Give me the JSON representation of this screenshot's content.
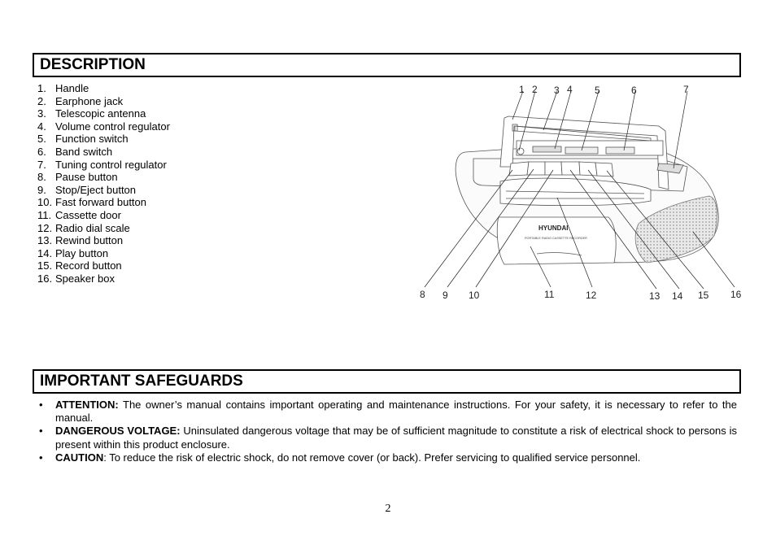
{
  "description": {
    "title": "DESCRIPTION",
    "parts": [
      {
        "num": "1.",
        "label": "Handle"
      },
      {
        "num": "2.",
        "label": "Earphone jack"
      },
      {
        "num": "3.",
        "label": "Telescopic antenna"
      },
      {
        "num": "4.",
        "label": "Volume control regulator"
      },
      {
        "num": "5.",
        "label": "Function switch"
      },
      {
        "num": "6.",
        "label": "Band switch"
      },
      {
        "num": "7.",
        "label": "Tuning control regulator"
      },
      {
        "num": "8.",
        "label": "Pause button"
      },
      {
        "num": "9.",
        "label": "Stop/Eject button"
      },
      {
        "num": "10.",
        "label": "Fast forward button"
      },
      {
        "num": "11.",
        "label": "Cassette door"
      },
      {
        "num": "12.",
        "label": "Radio dial scale"
      },
      {
        "num": "13.",
        "label": "Rewind button"
      },
      {
        "num": "14.",
        "label": "Play button"
      },
      {
        "num": "15.",
        "label": "Record button"
      },
      {
        "num": "16.",
        "label": "Speaker box"
      }
    ]
  },
  "diagram": {
    "brand": "HYUNDAI",
    "subtitle": "PORTABLE RADIO CASSETTE RECORDER",
    "callouts_top": [
      "1",
      "2",
      "3",
      "4",
      "5",
      "6",
      "7"
    ],
    "callouts_bottom": [
      "8",
      "9",
      "10",
      "11",
      "12",
      "13",
      "14",
      "15",
      "16"
    ]
  },
  "safeguards": {
    "title": "IMPORTANT SAFEGUARDS",
    "bullet": "•",
    "items": [
      {
        "label": "ATTENTION:",
        "text": " The owner’s manual contains important operating and maintenance instructions. For your safety, it is necessary to refer to the manual."
      },
      {
        "label": "DANGEROUS VOLTAGE:",
        "text": " Uninsulated dangerous voltage that may be of sufficient magnitude to constitute a risk of electrical shock to persons is present within this product enclosure."
      },
      {
        "label": "CAUTION",
        "text": ":  To reduce the risk of electric shock, do not remove cover (or back). Prefer servicing to qualified service personnel."
      }
    ]
  },
  "page_number": "2"
}
